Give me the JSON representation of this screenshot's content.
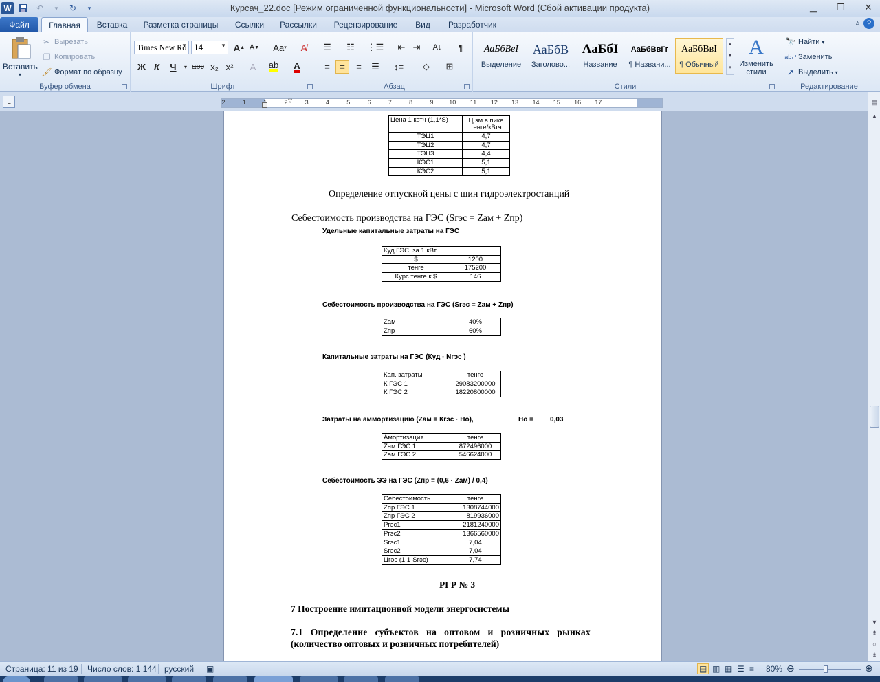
{
  "window": {
    "title": "Курсач_22.doc [Режим ограниченной функциональности]  -  Microsoft Word (Сбой активации продукта)",
    "app_letter": "W"
  },
  "tabs": [
    "Файл",
    "Главная",
    "Вставка",
    "Разметка страницы",
    "Ссылки",
    "Рассылки",
    "Рецензирование",
    "Вид",
    "Разработчик"
  ],
  "ribbon": {
    "clipboard": {
      "paste": "Вставить",
      "cut": "Вырезать",
      "copy": "Копировать",
      "format_painter": "Формат по образцу",
      "label": "Буфер обмена"
    },
    "font": {
      "name": "Times New Ro",
      "size": "14",
      "label": "Шрифт",
      "bold": "Ж",
      "italic": "К",
      "underline": "Ч",
      "strike": "abc",
      "sub": "x₂",
      "sup": "x²",
      "case": "Aa"
    },
    "paragraph": {
      "label": "Абзац"
    },
    "styles": {
      "label": "Стили",
      "items": [
        {
          "preview": "АаБбВеI",
          "name": "Выделение"
        },
        {
          "preview": "АаБбВ",
          "name": "Заголово..."
        },
        {
          "preview": "АаБбІ",
          "name": "Название"
        },
        {
          "preview": "АаБбВвГг",
          "name": "¶ Названи..."
        },
        {
          "preview": "АаБбВвI",
          "name": "¶ Обычный"
        }
      ],
      "change": "Изменить стили"
    },
    "editing": {
      "find": "Найти",
      "replace": "Заменить",
      "select": "Выделить",
      "label": "Редактирование"
    }
  },
  "ruler_numbers": [
    "2",
    "1",
    "1",
    "2",
    "3",
    "4",
    "5",
    "6",
    "7",
    "8",
    "9",
    "10",
    "11",
    "12",
    "13",
    "14",
    "15",
    "16",
    "17"
  ],
  "document": {
    "table_price": {
      "header": [
        "Цена 1 квтч (1,1*S)",
        "Ц зм в пике тенге/кВтч"
      ],
      "rows": [
        [
          "ТЭЦ1",
          "4,7"
        ],
        [
          "ТЭЦ2",
          "4,7"
        ],
        [
          "ТЭЦ3",
          "4,4"
        ],
        [
          "КЭС1",
          "5,1"
        ],
        [
          "КЭС2",
          "5,1"
        ]
      ]
    },
    "heading_price": "Определение отпускной цены с шин гидроэлектростанций",
    "heading_cost": "Себестоимость производства на ГЭС (Sгэс = Zам + Zпр)",
    "caption_specific": "Удельные капитальные затраты на ГЭС",
    "table_specific": {
      "rows": [
        [
          "Куд ГЭС, за 1 кВт",
          ""
        ],
        [
          "$",
          "1200"
        ],
        [
          "тенге",
          "175200"
        ],
        [
          "Курс тенге к $",
          "146"
        ]
      ]
    },
    "caption_cost2": "Себестоимость производства на ГЭС (Sгэс = Zам + Zпр)",
    "table_shares": {
      "rows": [
        [
          "Zам",
          "40%"
        ],
        [
          "Zпр",
          "60%"
        ]
      ]
    },
    "caption_capital": "Капитальные затраты на ГЭС (Куд · Nгэс )",
    "table_capital": {
      "rows": [
        [
          "Кап. затраты",
          "тенге"
        ],
        [
          "К ГЭС 1",
          "29083200000"
        ],
        [
          "К ГЭС 2",
          "18220800000"
        ]
      ]
    },
    "caption_amort": "Затраты на аммортизацию (Zам = Кгэс · Но),",
    "caption_amort_h": "Но =",
    "caption_amort_v": "0,03",
    "table_amort": {
      "rows": [
        [
          "Амортизация",
          "тенге"
        ],
        [
          "Zам ГЭС 1",
          "872496000"
        ],
        [
          "Zам ГЭС 2",
          "546624000"
        ]
      ]
    },
    "caption_ee": "Себестоимость ЭЭ на ГЭС (Zпр = (0,6 · Zам) / 0,4)",
    "table_ee": {
      "rows": [
        [
          "Себестоимость",
          "тенге"
        ],
        [
          "Zпр ГЭС 1",
          "1308744000"
        ],
        [
          "Zпр ГЭС 2",
          "819936000"
        ],
        [
          "Ргэс1",
          "2181240000"
        ],
        [
          "Ргэс2",
          "1366560000"
        ],
        [
          "Sгэс1",
          "7,04"
        ],
        [
          "Sгэс2",
          "7,04"
        ],
        [
          "Цгэс (1,1·Sгэс)",
          "7,74"
        ]
      ]
    },
    "rgr": "РГР № 3",
    "section7": "7 Построение имитационной модели энергосистемы",
    "section71_l1": "7.1   Определение   субъектов   на   оптовом   и   розничных   рынках",
    "section71_l2": "(количество оптовых и розничных потребителей)"
  },
  "status": {
    "page": "Страница: 11 из 19",
    "words": "Число слов: 1 144",
    "lang": "русский",
    "zoom": "80%"
  }
}
